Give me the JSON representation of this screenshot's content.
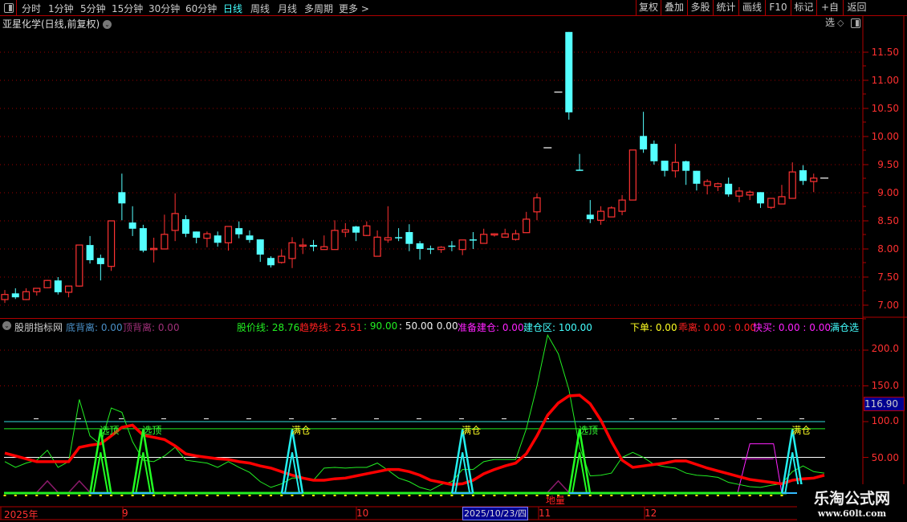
{
  "toolbar": {
    "periods": [
      {
        "label": "分时"
      },
      {
        "label": "1分钟"
      },
      {
        "label": "5分钟"
      },
      {
        "label": "15分钟"
      },
      {
        "label": "30分钟"
      },
      {
        "label": "60分钟"
      },
      {
        "label": "日线",
        "active": true
      },
      {
        "label": "周线"
      },
      {
        "label": "月线"
      },
      {
        "label": "多周期"
      },
      {
        "label": "更多 >"
      }
    ],
    "buttons": [
      {
        "label": "复权"
      },
      {
        "label": "叠加"
      },
      {
        "label": "多股"
      },
      {
        "label": "统计"
      },
      {
        "label": "画线"
      },
      {
        "label": "F10"
      },
      {
        "label": "标记"
      },
      {
        "label": "+自选"
      },
      {
        "label": "返回"
      }
    ]
  },
  "stock_title": "亚星化学(日线,前复权)",
  "indicator_header": {
    "name": "股朋指标网",
    "items": [
      {
        "label": "底背离: 0.00",
        "color": "#4a90c8"
      },
      {
        "label": "顶背离: 0.00",
        "color": "#a0307a"
      },
      {
        "label": "股价线: 28.76",
        "color": "#22ee22"
      },
      {
        "label": "趋势线: 25.51",
        "color": "#ff2020"
      },
      {
        "label": ": 90.00",
        "color": "#22ee22"
      },
      {
        "label": ": 50.00",
        "color": "#eeeeee"
      },
      {
        "label": ": 0.00",
        "color": "#eeeeee"
      },
      {
        "label": "准备建仓: 0.00",
        "color": "#ff22ff"
      },
      {
        "label": "建仓区: 100.00",
        "color": "#44ffff"
      },
      {
        "label": "下单: 0.00",
        "color": "#ffff22"
      },
      {
        "label": "乖离: 0.00 : 0.00",
        "color": "#ff2020"
      },
      {
        "label": "快买: 0.00 : 0.00",
        "color": "#ff22ff"
      },
      {
        "label": "满仓选股",
        "color": "#44ffff"
      }
    ]
  },
  "price_axis": [
    "11.50",
    "11.00",
    "10.50",
    "10.00",
    "9.50",
    "9.00",
    "8.50",
    "8.00",
    "7.50",
    "7.00"
  ],
  "indicator_axis": [
    "200.0",
    "150.0",
    "100.0",
    "50.00"
  ],
  "current_value": "116.90",
  "time_axis": {
    "labels": [
      "2025年",
      "9",
      "10",
      "11",
      "12"
    ],
    "selected_date": "2025/10/23/四"
  },
  "signal_labels": {
    "top": "选顶",
    "full": "满仓",
    "low_volume": "地量"
  },
  "watermark": {
    "name": "乐淘公式网",
    "url": "www.60lt.com"
  },
  "colors": {
    "up": "#ff3232",
    "down": "#54ffff",
    "flat": "#ffffff",
    "trend": "#ff0000",
    "price_line": "#22ee22",
    "grid": "#9a0000"
  },
  "chart_data": [
    {
      "type": "candlestick",
      "title": "亚星化学(日线,前复权)",
      "ylim": [
        6.85,
        11.95
      ],
      "ohlc": [
        [
          7.1,
          7.27,
          7.04,
          7.19
        ],
        [
          7.21,
          7.3,
          7.11,
          7.14
        ],
        [
          7.1,
          7.3,
          7.09,
          7.24
        ],
        [
          7.24,
          7.3,
          7.17,
          7.3
        ],
        [
          7.31,
          7.45,
          7.3,
          7.44
        ],
        [
          7.44,
          7.5,
          7.19,
          7.23
        ],
        [
          7.23,
          7.34,
          7.14,
          7.34
        ],
        [
          7.34,
          8.07,
          7.33,
          8.07
        ],
        [
          8.07,
          8.23,
          7.74,
          7.8
        ],
        [
          7.84,
          7.9,
          7.44,
          7.73
        ],
        [
          7.69,
          8.5,
          7.61,
          8.5
        ],
        [
          9.01,
          9.34,
          8.51,
          8.81
        ],
        [
          8.47,
          8.76,
          8.23,
          8.36
        ],
        [
          8.37,
          8.43,
          7.94,
          7.97
        ],
        [
          7.99,
          8.2,
          7.76,
          8.01
        ],
        [
          8.0,
          8.61,
          8.0,
          8.26
        ],
        [
          8.33,
          8.99,
          8.14,
          8.63
        ],
        [
          8.53,
          8.6,
          8.21,
          8.27
        ],
        [
          8.31,
          8.31,
          8.1,
          8.2
        ],
        [
          8.19,
          8.31,
          8.03,
          8.27
        ],
        [
          8.24,
          8.31,
          8.04,
          8.11
        ],
        [
          8.11,
          8.4,
          7.97,
          8.4
        ],
        [
          8.37,
          8.49,
          8.19,
          8.26
        ],
        [
          8.24,
          8.33,
          8.11,
          8.16
        ],
        [
          8.17,
          8.17,
          7.77,
          7.9
        ],
        [
          7.84,
          7.87,
          7.67,
          7.71
        ],
        [
          7.76,
          7.99,
          7.74,
          7.87
        ],
        [
          7.83,
          8.21,
          7.66,
          8.11
        ],
        [
          8.06,
          8.19,
          7.91,
          8.07
        ],
        [
          8.07,
          8.16,
          7.96,
          8.04
        ],
        [
          7.99,
          8.24,
          7.99,
          8.04
        ],
        [
          7.99,
          8.51,
          7.99,
          8.33
        ],
        [
          8.3,
          8.46,
          8.21,
          8.34
        ],
        [
          8.4,
          8.41,
          8.14,
          8.29
        ],
        [
          8.24,
          8.49,
          8.23,
          8.41
        ],
        [
          7.87,
          8.33,
          7.87,
          8.21
        ],
        [
          8.16,
          8.76,
          8.11,
          8.2
        ],
        [
          8.21,
          8.37,
          8.14,
          8.2
        ],
        [
          8.3,
          8.44,
          7.96,
          8.09
        ],
        [
          8.1,
          8.14,
          7.81,
          8.0
        ],
        [
          8.01,
          8.06,
          7.91,
          8.0
        ],
        [
          7.99,
          8.05,
          7.93,
          8.03
        ],
        [
          8.06,
          8.14,
          7.96,
          8.04
        ],
        [
          7.99,
          8.16,
          7.89,
          8.16
        ],
        [
          8.17,
          8.3,
          8.0,
          8.16
        ],
        [
          8.1,
          8.36,
          8.1,
          8.26
        ],
        [
          8.25,
          8.28,
          8.22,
          8.27
        ],
        [
          8.21,
          8.36,
          8.21,
          8.27
        ],
        [
          8.17,
          8.34,
          8.15,
          8.27
        ],
        [
          8.29,
          8.66,
          8.29,
          8.53
        ],
        [
          8.66,
          8.99,
          8.51,
          8.91
        ],
        [
          9.8,
          9.8,
          9.8,
          9.8
        ],
        [
          10.79,
          10.79,
          10.79,
          10.79
        ],
        [
          11.86,
          11.86,
          10.3,
          10.43
        ],
        [
          9.41,
          9.69,
          9.4,
          9.4
        ],
        [
          8.61,
          8.87,
          8.46,
          8.53
        ],
        [
          8.51,
          8.76,
          8.43,
          8.67
        ],
        [
          8.57,
          8.76,
          8.57,
          8.73
        ],
        [
          8.67,
          8.96,
          8.6,
          8.87
        ],
        [
          8.87,
          9.76,
          8.87,
          9.76
        ],
        [
          10.01,
          10.44,
          9.71,
          9.77
        ],
        [
          9.87,
          9.93,
          9.5,
          9.56
        ],
        [
          9.57,
          9.57,
          9.29,
          9.39
        ],
        [
          9.39,
          9.87,
          9.27,
          9.54
        ],
        [
          9.56,
          9.57,
          9.14,
          9.39
        ],
        [
          9.39,
          9.39,
          9.04,
          9.16
        ],
        [
          9.13,
          9.24,
          8.97,
          9.2
        ],
        [
          9.11,
          9.18,
          9.03,
          9.16
        ],
        [
          9.16,
          9.27,
          8.93,
          8.97
        ],
        [
          8.94,
          9.1,
          8.83,
          9.03
        ],
        [
          8.96,
          9.04,
          8.87,
          9.01
        ],
        [
          9.01,
          9.01,
          8.73,
          8.81
        ],
        [
          8.74,
          8.9,
          8.71,
          8.9
        ],
        [
          8.8,
          9.14,
          8.8,
          8.93
        ],
        [
          8.9,
          9.54,
          8.9,
          9.37
        ],
        [
          9.4,
          9.49,
          9.14,
          9.21
        ],
        [
          9.2,
          9.34,
          9.01,
          9.26
        ],
        [
          9.26,
          9.26,
          9.26,
          9.26
        ]
      ]
    },
    {
      "type": "line",
      "title": "股朋指标网",
      "ylim": [
        0,
        230
      ],
      "reference_lines": [
        100,
        90,
        50,
        0
      ],
      "series": [
        {
          "name": "股价线",
          "values": [
            44,
            36,
            42,
            46,
            60,
            36,
            44,
            131,
            80,
            68,
            119,
            113,
            72,
            46,
            44,
            52,
            64,
            46,
            44,
            42,
            36,
            44,
            36,
            29,
            16,
            8,
            13,
            21,
            21,
            18,
            35,
            36,
            35,
            36,
            36,
            42,
            32,
            21,
            16,
            8,
            4,
            12,
            16,
            33,
            33,
            44,
            47,
            47,
            47,
            90,
            150,
            221,
            195,
            145,
            64,
            24,
            25,
            28,
            50,
            57,
            50,
            40,
            37,
            35,
            28,
            25,
            24,
            22,
            15,
            12,
            9,
            8,
            11,
            13,
            30,
            38,
            30,
            28
          ]
        },
        {
          "name": "趋势线",
          "values": [
            56,
            52,
            48,
            44,
            44,
            44,
            44,
            64,
            67,
            69,
            80,
            92,
            95,
            81,
            78,
            75,
            66,
            55,
            52,
            50,
            48,
            47,
            44,
            42,
            38,
            35,
            30,
            25,
            21,
            18,
            18,
            20,
            21,
            24,
            27,
            30,
            33,
            33,
            30,
            25,
            18,
            15,
            12,
            13,
            18,
            27,
            33,
            38,
            42,
            55,
            80,
            109,
            126,
            136,
            137,
            125,
            102,
            72,
            46,
            36,
            38,
            40,
            42,
            45,
            45,
            40,
            35,
            31,
            27,
            23,
            19,
            17,
            15,
            13,
            18,
            20,
            21,
            25
          ]
        }
      ],
      "signals": {
        "top_spikes": [
          9,
          13,
          54
        ],
        "full_spikes": [
          27,
          43,
          74
        ],
        "divergence_marks": [
          4,
          7,
          52
        ],
        "prepare_zone": {
          "start": 69,
          "end": 73,
          "outer": 69,
          "inner": 48
        },
        "low_volume": 52
      }
    }
  ]
}
